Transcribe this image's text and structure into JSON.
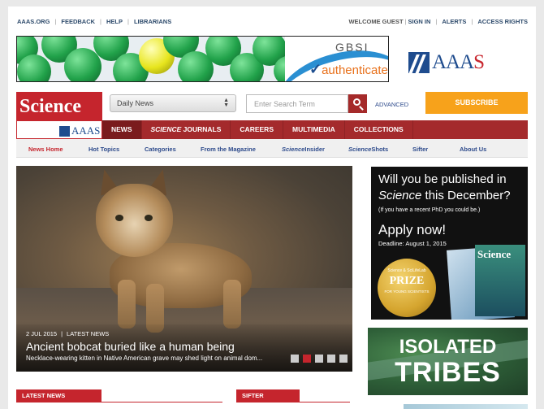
{
  "topbar": {
    "left_links": [
      "AAAS.ORG",
      "FEEDBACK",
      "HELP",
      "LIBRARIANS"
    ],
    "welcome": "WELCOME GUEST",
    "sign_in": "SIGN IN",
    "alerts": "ALERTS",
    "access_rights": "ACCESS RIGHTS"
  },
  "banner": {
    "gbsi": "GBSI",
    "authenticate": "authenticate"
  },
  "aaas_logo": {
    "text_main": "AAA",
    "text_accent": "S"
  },
  "brand": {
    "science": "Science",
    "aaas": "AAAS"
  },
  "search": {
    "section_select": "Daily News",
    "placeholder": "Enter Search Term",
    "advanced": "ADVANCED"
  },
  "subscribe": "SUBSCRIBE",
  "main_nav": {
    "news": "NEWS",
    "science_journals_italic": "SCIENCE",
    "science_journals_rest": " JOURNALS",
    "careers": "CAREERS",
    "multimedia": "MULTIMEDIA",
    "collections": "COLLECTIONS"
  },
  "sub_nav": {
    "news_home": "News Home",
    "hot_topics": "Hot Topics",
    "categories": "Categories",
    "from_magazine": "From the Magazine",
    "science_insider_italic": "Science",
    "science_insider_rest": "Insider",
    "science_shots_italic": "Science",
    "science_shots_rest": "Shots",
    "sifter": "Sifter",
    "about_us": "About Us"
  },
  "hero": {
    "date": "2 JUL 2015",
    "category": "LATEST NEWS",
    "title": "Ancient bobcat buried like a human being",
    "description": "Necklace-wearing kitten in Native American grave may shed light on animal dom...",
    "active_slide": 2,
    "slide_count": 5
  },
  "ad_prize": {
    "line1": "Will you be published in",
    "line2_italic": "Science",
    "line2_rest": " this December?",
    "line3": "(If you have a recent PhD you could be.)",
    "apply": "Apply now!",
    "deadline": "Deadline: August 1, 2015",
    "medal_top": "Science & SciLifeLab",
    "medal_main": "PRIZE",
    "medal_bottom": "FOR YOUNG SCIENTISTS",
    "magazine": "Science"
  },
  "ad_tribes": {
    "line1": "ISOLATED",
    "line2": "TRIBES"
  },
  "sections": {
    "latest_news": "LATEST NEWS",
    "sifter": "SIFTER"
  },
  "colors": {
    "brand_red": "#c5252d",
    "nav_red": "#a42a2c",
    "subscribe_orange": "#f7a21b",
    "link_blue": "#2d4a8b"
  }
}
